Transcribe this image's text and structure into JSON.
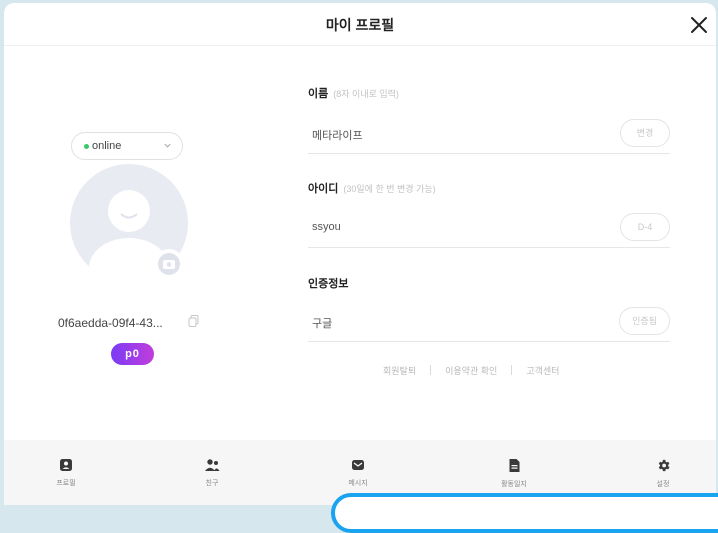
{
  "header": {
    "title": "마이 프로필"
  },
  "profile": {
    "status": "online",
    "user_id": "0f6aedda-09f4-43...",
    "badge": "p0"
  },
  "fields": {
    "name": {
      "label": "이름",
      "hint": "(8자 이내로 입력)",
      "value": "메타라이프",
      "button": "변경"
    },
    "id": {
      "label": "아이디",
      "hint": "(30일에 한 번 변경 가능)",
      "value": "ssyou",
      "button": "D-4"
    },
    "auth": {
      "label": "인증정보",
      "value": "구글",
      "button": "인증됨"
    }
  },
  "links": {
    "withdraw": "회원탈퇴",
    "terms": "이용약관 확인",
    "support": "고객센터"
  },
  "nav": [
    {
      "label": "프로필",
      "icon": "profile-icon"
    },
    {
      "label": "친구",
      "icon": "friends-icon"
    },
    {
      "label": "메시지",
      "icon": "message-icon"
    },
    {
      "label": "활동일지",
      "icon": "activity-log-icon"
    },
    {
      "label": "설정",
      "icon": "settings-icon"
    }
  ],
  "colors": {
    "accent": "#1aa3ef",
    "online": "#3cc86a",
    "badge_start": "#7b3cf5",
    "badge_end": "#c13ddc"
  }
}
